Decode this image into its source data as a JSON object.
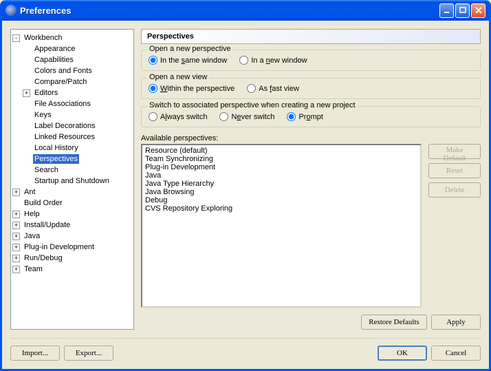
{
  "window": {
    "title": "Preferences"
  },
  "tree": {
    "root": {
      "label": "Workbench",
      "exp": "-"
    },
    "workbench_children": [
      {
        "label": "Appearance",
        "exp": ""
      },
      {
        "label": "Capabilities",
        "exp": ""
      },
      {
        "label": "Colors and Fonts",
        "exp": ""
      },
      {
        "label": "Compare/Patch",
        "exp": ""
      },
      {
        "label": "Editors",
        "exp": "+"
      },
      {
        "label": "File Associations",
        "exp": ""
      },
      {
        "label": "Keys",
        "exp": ""
      },
      {
        "label": "Label Decorations",
        "exp": ""
      },
      {
        "label": "Linked Resources",
        "exp": ""
      },
      {
        "label": "Local History",
        "exp": ""
      },
      {
        "label": "Perspectives",
        "exp": "",
        "selected": true
      },
      {
        "label": "Search",
        "exp": ""
      },
      {
        "label": "Startup and Shutdown",
        "exp": ""
      }
    ],
    "siblings": [
      {
        "label": "Ant",
        "exp": "+"
      },
      {
        "label": "Build Order",
        "exp": ""
      },
      {
        "label": "Help",
        "exp": "+"
      },
      {
        "label": "Install/Update",
        "exp": "+"
      },
      {
        "label": "Java",
        "exp": "+"
      },
      {
        "label": "Plug-in Development",
        "exp": "+"
      },
      {
        "label": "Run/Debug",
        "exp": "+"
      },
      {
        "label": "Team",
        "exp": "+"
      }
    ]
  },
  "page": {
    "title": "Perspectives",
    "group1": {
      "legend": "Open a new perspective",
      "opt1_pre": "In the ",
      "opt1_ul": "s",
      "opt1_post": "ame window",
      "opt2_pre": "In a ",
      "opt2_ul": "n",
      "opt2_post": "ew window"
    },
    "group2": {
      "legend": "Open a new view",
      "opt1_ul": "W",
      "opt1_post": "ithin the perspective",
      "opt2_pre": "As ",
      "opt2_ul": "f",
      "opt2_post": "ast view"
    },
    "group3": {
      "legend": "Switch to associated perspective when creating a new project",
      "opt1_pre": "A",
      "opt1_ul": "l",
      "opt1_post": "ways switch",
      "opt2_pre": "N",
      "opt2_ul": "e",
      "opt2_post": "ver switch",
      "opt3_pre": "Pr",
      "opt3_ul": "o",
      "opt3_post": "mpt"
    },
    "available_label": "Available perspectives:",
    "perspectives": [
      "Resource (default)",
      "Team Synchronizing",
      "Plug-in Development",
      "Java",
      "Java Type Hierarchy",
      "Java Browsing",
      "Debug",
      "CVS Repository Exploring"
    ],
    "btn_make_default": "Make Default",
    "btn_reset": "Reset",
    "btn_delete": "Delete",
    "btn_restore": "Restore Defaults",
    "btn_apply": "Apply"
  },
  "footer": {
    "import": "Import...",
    "export": "Export...",
    "ok": "OK",
    "cancel": "Cancel"
  }
}
